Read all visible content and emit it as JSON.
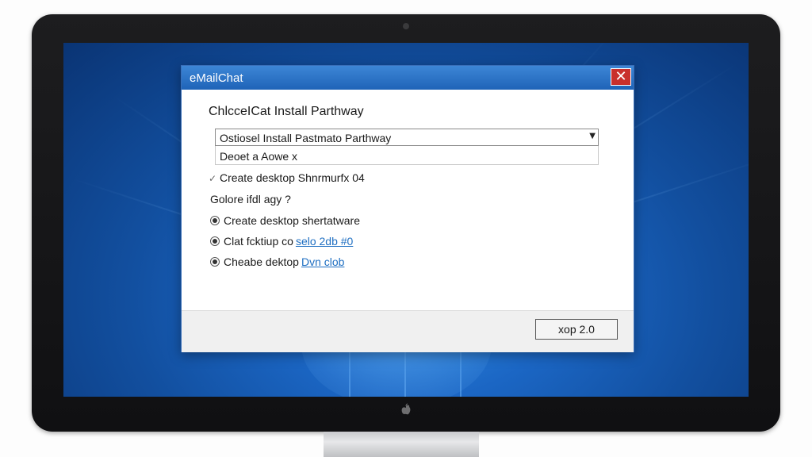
{
  "dialog": {
    "title": "eMailChat",
    "close_glyph": "✕",
    "heading": "ChlcceICat Install Parthway",
    "select": {
      "value": "Ostiosel Install Pastmato Parthway",
      "arrow_glyph": "▼"
    },
    "dropdown_option": "Deoet a Aowe x",
    "checkbox": {
      "glyph": "✓",
      "label": "Create desktop Shnrmurfx 04"
    },
    "question": "Golore ifdl agy ?",
    "radio_options": [
      {
        "label": "Create desktop shertatware",
        "link": ""
      },
      {
        "label": "Clat fcktiup co",
        "link": "selo  2db #0"
      },
      {
        "label": "Cheabe dektop",
        "link": "Dvn clob"
      }
    ],
    "ok_button": "xop 2.0"
  },
  "colors": {
    "titlebar": "#1f63b8",
    "close_button": "#c9302c",
    "link": "#1f6fc2",
    "desktop": "#1b66c4"
  },
  "icons": [
    "close-icon",
    "chevron-down-icon",
    "checkmark-icon",
    "radio-selected-icon",
    "apple-logo-icon"
  ]
}
